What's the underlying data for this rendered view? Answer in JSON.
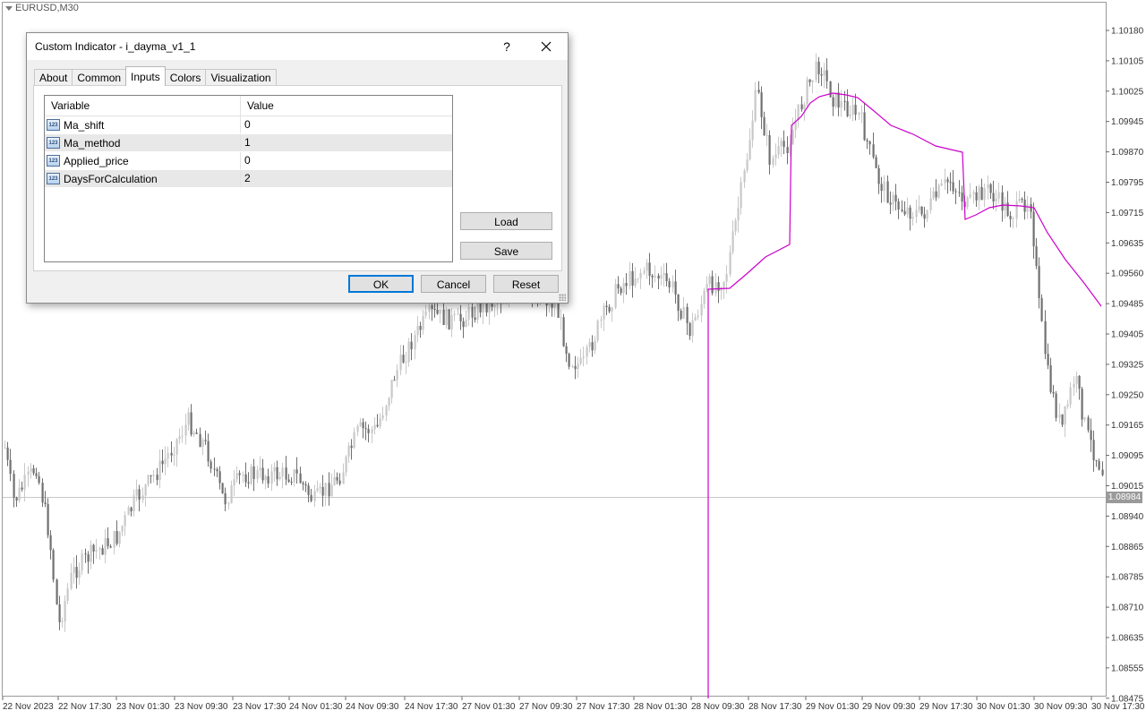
{
  "chart": {
    "symbol": "EURUSD,M30",
    "current_price": "1.08984",
    "price_levels": [
      "1.10180",
      "1.10105",
      "1.10025",
      "1.09945",
      "1.09870",
      "1.09795",
      "1.09715",
      "1.09635",
      "1.09560",
      "1.09485",
      "1.09405",
      "1.09325",
      "1.09250",
      "1.09165",
      "1.09095",
      "1.09015",
      "1.08940",
      "1.08865",
      "1.08785",
      "1.08710",
      "1.08635",
      "1.08555",
      "1.08475"
    ],
    "time_labels": [
      "22 Nov 2023",
      "22 Nov 17:30",
      "23 Nov 01:30",
      "23 Nov 09:30",
      "23 Nov 17:30",
      "24 Nov 01:30",
      "24 Nov 09:30",
      "24 Nov 17:30",
      "27 Nov 01:30",
      "27 Nov 09:30",
      "27 Nov 17:30",
      "28 Nov 01:30",
      "28 Nov 09:30",
      "28 Nov 17:30",
      "29 Nov 01:30",
      "29 Nov 09:30",
      "29 Nov 17:30",
      "30 Nov 01:30",
      "30 Nov 09:30",
      "30 Nov 17:30"
    ],
    "indicator_color": "#cc00cc",
    "bull_color": "#c8c8c8",
    "bear_color": "#707070"
  },
  "dialog": {
    "title": "Custom Indicator - i_dayma_v1_1",
    "help_label": "?",
    "tabs": [
      "About",
      "Common",
      "Inputs",
      "Colors",
      "Visualization"
    ],
    "active_tab": "Inputs",
    "table": {
      "headers": [
        "Variable",
        "Value"
      ],
      "icon_text": "123",
      "rows": [
        {
          "variable": "Ma_shift",
          "value": "0"
        },
        {
          "variable": "Ma_method",
          "value": "1"
        },
        {
          "variable": "Applied_price",
          "value": "0"
        },
        {
          "variable": "DaysForCalculation",
          "value": "2"
        }
      ]
    },
    "buttons": {
      "load": "Load",
      "save": "Save",
      "ok": "OK",
      "cancel": "Cancel",
      "reset": "Reset"
    }
  }
}
